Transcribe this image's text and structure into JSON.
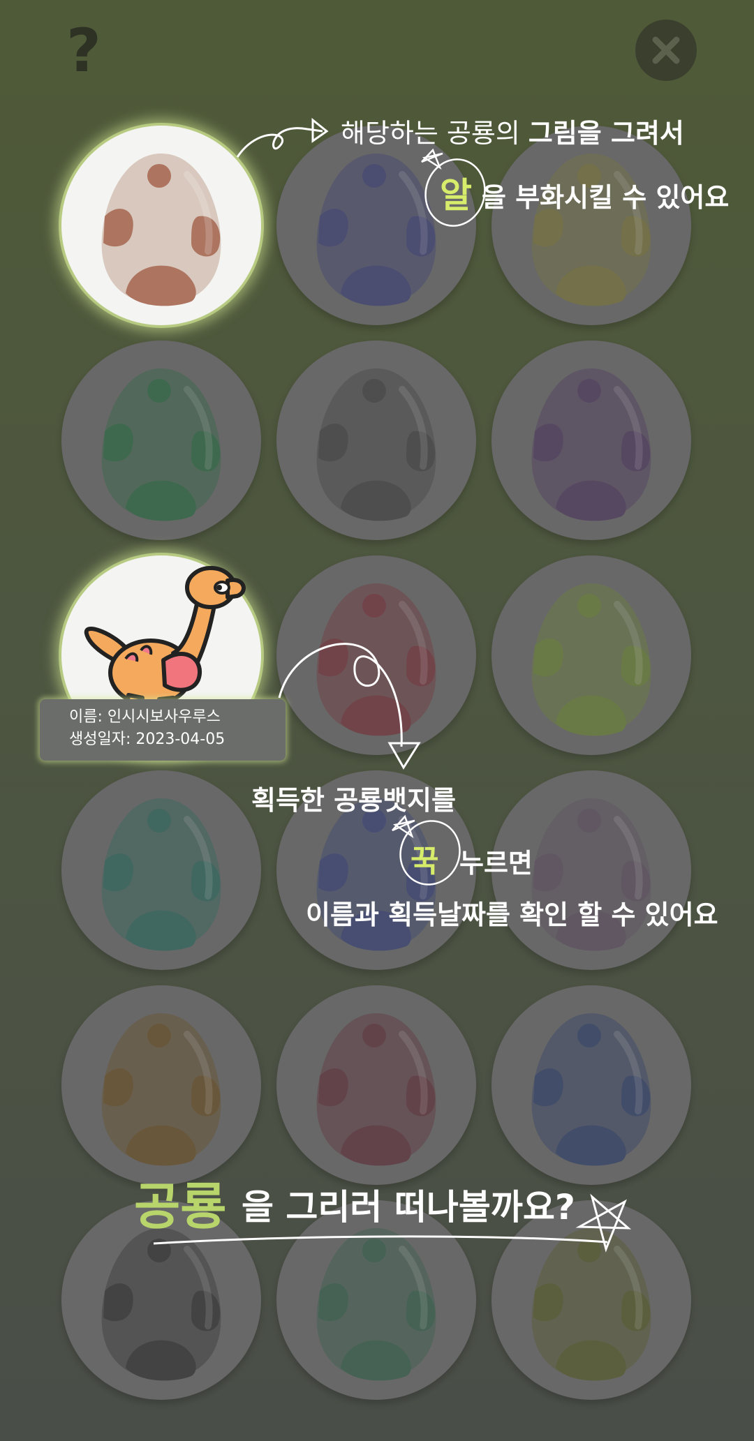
{
  "header": {
    "help_icon_text": "?",
    "help_icon": "question-mark-icon",
    "close_icon": "close-icon"
  },
  "eggs": [
    {
      "state": "active",
      "color": "#b98a73"
    },
    {
      "state": "locked",
      "color": "#34387a"
    },
    {
      "state": "locked",
      "color": "#7e7833"
    },
    {
      "state": "locked",
      "color": "#1f6a3a"
    },
    {
      "state": "locked",
      "color": "#3a3a3a"
    },
    {
      "state": "locked",
      "color": "#4a2e5e"
    },
    {
      "state": "hatched",
      "dinosaur_icon": "orange-dinosaur-icon"
    },
    {
      "state": "locked",
      "color": "#7a2830"
    },
    {
      "state": "locked",
      "color": "#6d8a2c"
    },
    {
      "state": "locked",
      "color": "#20675a"
    },
    {
      "state": "locked",
      "color": "#2e3a7a"
    },
    {
      "state": "locked",
      "color": "#5a4a5e"
    },
    {
      "state": "locked",
      "color": "#6b4a18"
    },
    {
      "state": "locked",
      "color": "#5e2530"
    },
    {
      "state": "locked",
      "color": "#24386a"
    },
    {
      "state": "locked",
      "color": "#262626"
    },
    {
      "state": "locked",
      "color": "#2a5e44"
    },
    {
      "state": "locked",
      "color": "#52581a"
    }
  ],
  "tooltip": {
    "name_line": "이름: 인시시보사우루스",
    "date_line": "생성일자: 2023-04-05"
  },
  "annotations": {
    "top_line1_normal": "해당하는 공룡의 ",
    "top_line1_bold": "그림을 그려서",
    "top_highlight": "알",
    "top_line2": "을 부화시킬 수 있어요",
    "mid_line1": "획득한 공룡뱃지를",
    "mid_highlight": "꾹",
    "mid_line2": "누르면",
    "mid_line3": "이름과 획득날짜를 확인 할 수 있어요",
    "bottom_big": "공룡",
    "bottom_rest": "을 그리러 떠나볼까요?"
  },
  "colors": {
    "accent_green": "#d6ec6a",
    "bottom_word_green": "#b7d56b",
    "cell_dark": "#686868",
    "cell_active": "#f4f4f2"
  }
}
